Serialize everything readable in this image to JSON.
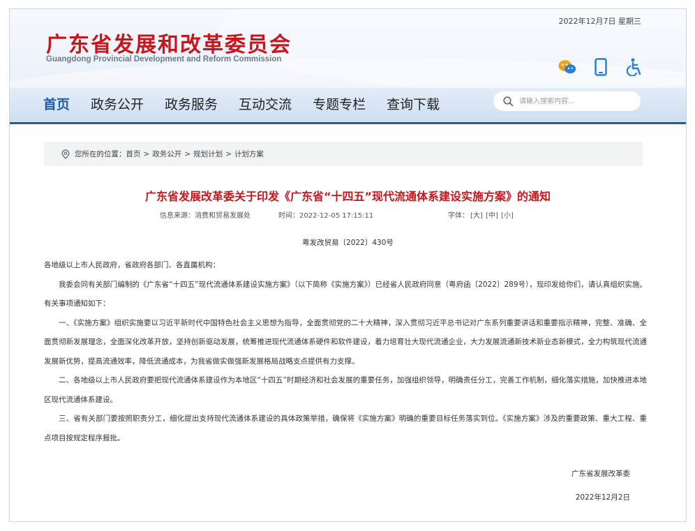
{
  "header": {
    "date": "2022年12月7日 星期三",
    "title": "广东省发展和改革委员会",
    "subtitle": "Guangdong Provincial Development and Reform Commission",
    "icons": [
      "wechat-icon",
      "mobile-icon",
      "accessibility-icon"
    ]
  },
  "nav": {
    "items": [
      {
        "label": "首页"
      },
      {
        "label": "政务公开"
      },
      {
        "label": "政务服务"
      },
      {
        "label": "互动交流"
      },
      {
        "label": "专题专栏"
      },
      {
        "label": "查询下载"
      }
    ],
    "search_placeholder": "请输入搜索内容..."
  },
  "breadcrumb": {
    "prefix": "您所在的位置：",
    "items": [
      "首页",
      "政务公开",
      "规划计划",
      "计划方案"
    ],
    "separator": ">"
  },
  "article": {
    "title": "广东省发展改革委关于印发《广东省“十四五”现代流通体系建设实施方案》的通知",
    "source": "信息来源：消费和贸易发展处",
    "time": "时间：2022-12-05 17:15:11",
    "font_label": "字体：",
    "font_sizes": [
      "[大]",
      "[中]",
      "[小]"
    ],
    "doc_no": "粤发改贸易〔2022〕430号",
    "salutation": "各地级以上市人民政府，省政府各部门、各直属机构：",
    "paragraphs": [
      "我委会同有关部门编制的《广东省“十四五”现代流通体系建设实施方案》（以下简称《实施方案》）已经省人民政府同意（粤府函〔2022〕289号），现印发给你们，请认真组织实施。有关事项通知如下：",
      "一、《实施方案》组织实施要以习近平新时代中国特色社会主义思想为指导，全面贯彻党的二十大精神，深入贯彻习近平总书记对广东系列重要讲话和重要指示精神，完整、准确、全面贯彻新发展理念，全面深化改革开放，坚持创新驱动发展，统筹推进现代流通体系硬件和软件建设，着力培育壮大现代流通企业，大力发展流通新技术新业态新模式，全力构筑现代流通发展新优势，提高流通效率，降低流通成本，为我省做实做强新发展格局战略支点提供有力支撑。",
      "二、各地级以上市人民政府要把现代流通体系建设作为本地区“十四五”时期经济和社会发展的重要任务，加强组织领导，明确责任分工，完善工作机制，细化落实措施，加快推进本地区现代流通体系建设。",
      "三、省有关部门要按照职责分工，细化提出支持现代流通体系建设的具体政策举措，确保将《实施方案》明确的重要目标任务落实到位。《实施方案》涉及的重要政策、重大工程、重点项目按规定程序报批。"
    ],
    "signature": "广东省发展改革委",
    "sign_date": "2022年12月2日"
  },
  "colors": {
    "brand_red": "#c8161d",
    "nav_blue": "#1c5ca8",
    "icon_blue": "#2a7fd4",
    "wechat_orange": "#f0a020"
  }
}
